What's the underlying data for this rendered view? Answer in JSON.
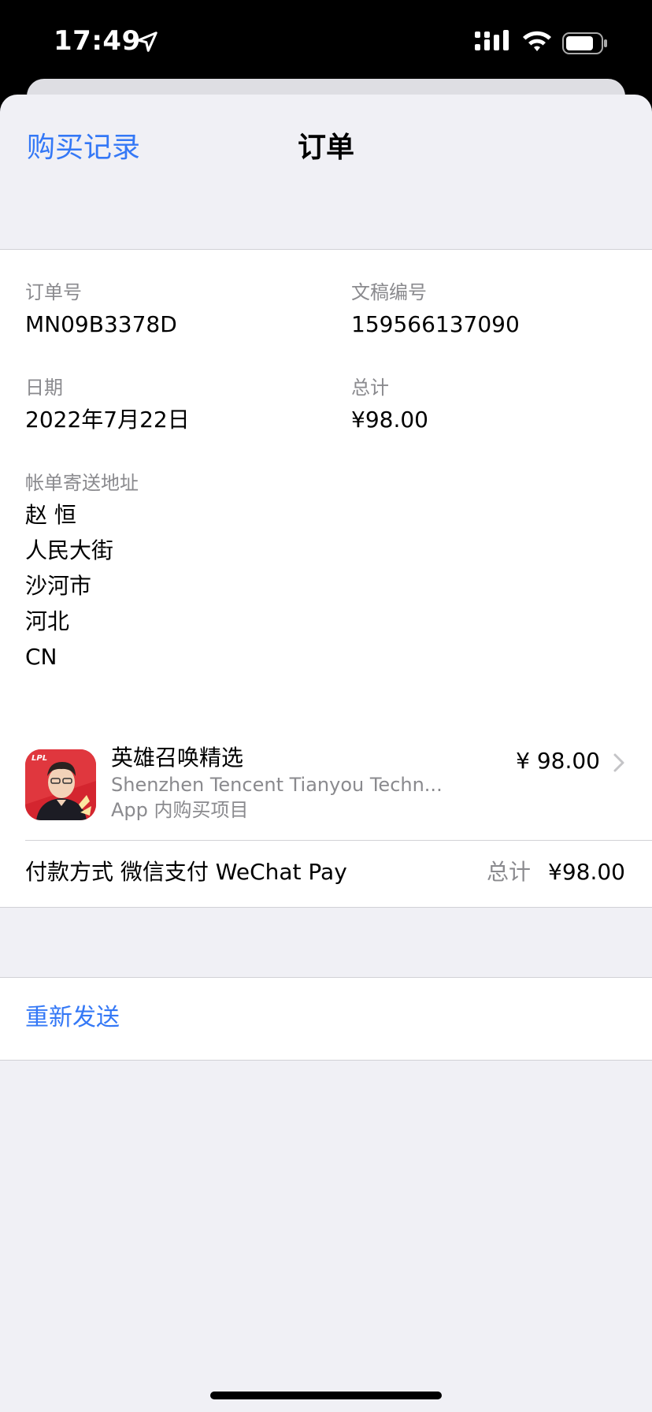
{
  "status_bar": {
    "time": "17:49",
    "icons": [
      "location-arrow-icon",
      "cellular-signal-icon",
      "wifi-icon",
      "battery-icon"
    ]
  },
  "nav": {
    "back_label": "购买记录",
    "title": "订单"
  },
  "order": {
    "order_no_label": "订单号",
    "order_no": "MN09B3378D",
    "doc_no_label": "文稿编号",
    "doc_no": "159566137090",
    "date_label": "日期",
    "date": "2022年7月22日",
    "total_label": "总计",
    "total": "¥98.00",
    "billing_label": "帐单寄送地址",
    "billing_lines": [
      "赵 恒",
      "人民大街",
      "沙河市",
      "河北",
      "CN"
    ]
  },
  "item": {
    "icon_badge": "LPL",
    "title": "英雄召唤精选",
    "developer": "Shenzhen Tencent Tianyou Techn...",
    "type": "App 内购买项目",
    "price": "¥ 98.00"
  },
  "payment": {
    "method": "付款方式 微信支付 WeChat Pay",
    "total_label": "总计",
    "total_value": "¥98.00"
  },
  "resend_label": "重新发送",
  "colors": {
    "accent": "#3478f6",
    "secondary_text": "#8a8a8e",
    "grouped_background": "#f0f0f5"
  }
}
